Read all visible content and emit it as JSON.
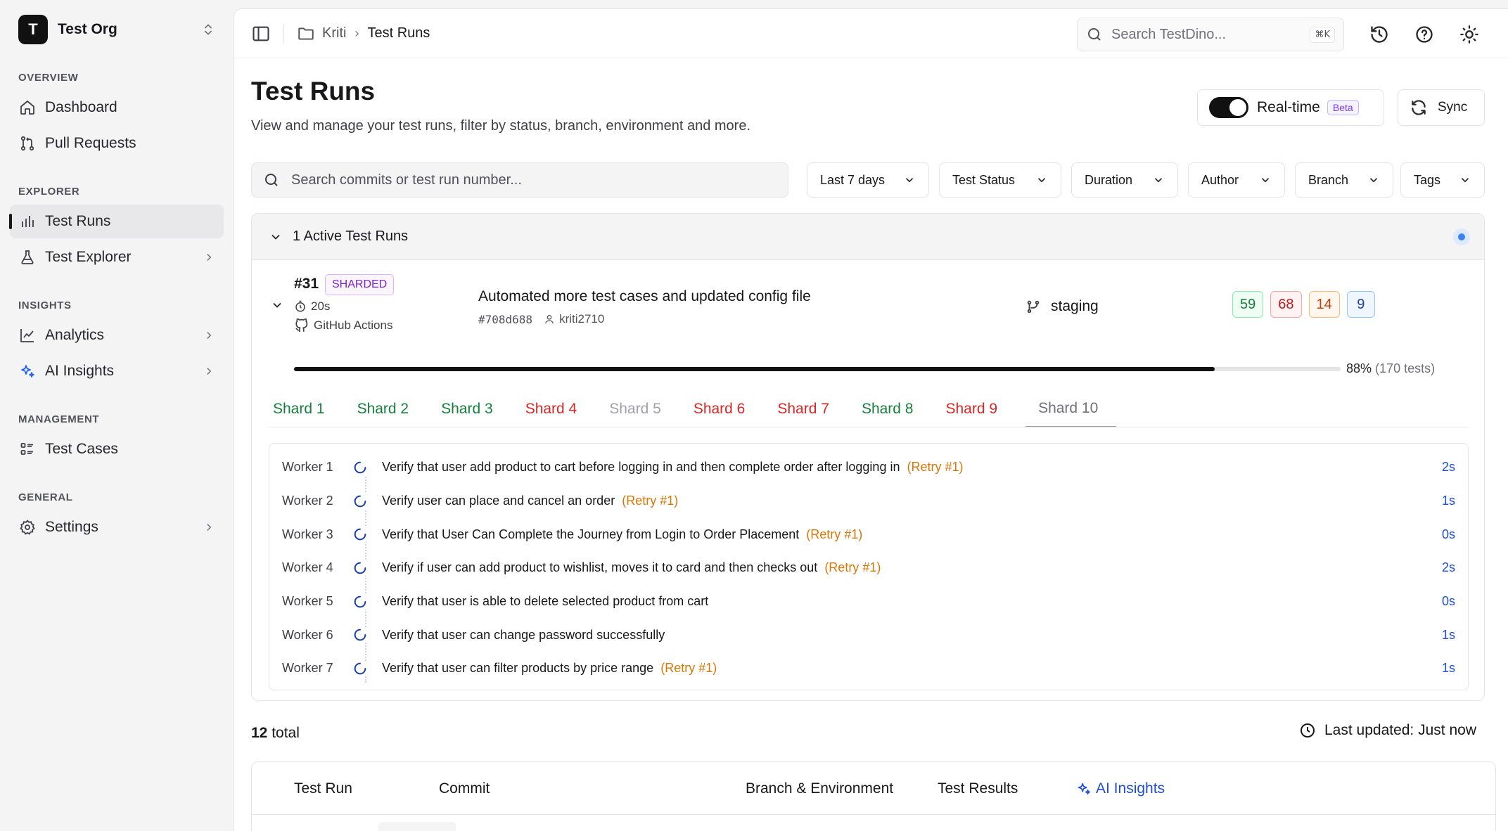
{
  "org": {
    "initial": "T",
    "name": "Test Org"
  },
  "sidebar": {
    "sections": [
      {
        "label": "OVERVIEW",
        "items": [
          {
            "label": "Dashboard",
            "icon": "home-icon"
          },
          {
            "label": "Pull Requests",
            "icon": "git-pull-request-icon"
          }
        ]
      },
      {
        "label": "EXPLORER",
        "items": [
          {
            "label": "Test Runs",
            "icon": "bar-chart-icon",
            "active": true
          },
          {
            "label": "Test Explorer",
            "icon": "flask-icon",
            "chevron": true
          }
        ]
      },
      {
        "label": "INSIGHTS",
        "items": [
          {
            "label": "Analytics",
            "icon": "line-chart-icon",
            "chevron": true
          },
          {
            "label": "AI Insights",
            "icon": "sparkles-icon",
            "chevron": true
          }
        ]
      },
      {
        "label": "MANAGEMENT",
        "items": [
          {
            "label": "Test Cases",
            "icon": "list-icon"
          }
        ]
      },
      {
        "label": "GENERAL",
        "items": [
          {
            "label": "Settings",
            "icon": "gear-icon",
            "chevron": true
          }
        ]
      }
    ]
  },
  "topbar": {
    "breadcrumb": [
      "Kriti",
      "Test Runs"
    ],
    "search_placeholder": "Search TestDino...",
    "search_shortcut": "⌘K"
  },
  "page": {
    "title": "Test Runs",
    "subtitle": "View and manage your test runs, filter by status, branch, environment and more.",
    "realtime_label": "Real-time",
    "realtime_on": true,
    "beta_label": "Beta",
    "sync_label": "Sync"
  },
  "filters": {
    "search_placeholder": "Search commits or test run number...",
    "buttons": [
      "Last 7 days",
      "Test Status",
      "Duration",
      "Author",
      "Branch",
      "Tags"
    ]
  },
  "active_runs": {
    "header": "1 Active Test Runs",
    "run": {
      "number": "#31",
      "badge": "SHARDED",
      "duration": "20s",
      "ci": "GitHub Actions",
      "commit_message": "Automated more test cases and updated config file",
      "commit_hash": "#708d688",
      "author": "kriti2710",
      "branch": "staging",
      "counts": {
        "passed": "59",
        "failed": "68",
        "flaky": "14",
        "skipped": "9"
      },
      "progress_percent": 88,
      "progress_label": "88%",
      "progress_tests": "(170 tests)"
    },
    "shards": [
      {
        "label": "Shard 1",
        "status": "green"
      },
      {
        "label": "Shard 2",
        "status": "green"
      },
      {
        "label": "Shard 3",
        "status": "green"
      },
      {
        "label": "Shard 4",
        "status": "red"
      },
      {
        "label": "Shard 5",
        "status": "gray"
      },
      {
        "label": "Shard 6",
        "status": "red"
      },
      {
        "label": "Shard 7",
        "status": "red"
      },
      {
        "label": "Shard 8",
        "status": "green"
      },
      {
        "label": "Shard 9",
        "status": "red"
      },
      {
        "label": "Shard 10",
        "status": "selected"
      }
    ],
    "workers": [
      {
        "name": "Worker 1",
        "test": "Verify that user add product to cart before logging in and then complete order after logging in",
        "retry": "(Retry #1)",
        "time": "2s"
      },
      {
        "name": "Worker 2",
        "test": "Verify user can place and cancel an order",
        "retry": "(Retry #1)",
        "time": "1s"
      },
      {
        "name": "Worker 3",
        "test": "Verify that User Can Complete the Journey from Login to Order Placement",
        "retry": "(Retry #1)",
        "time": "0s"
      },
      {
        "name": "Worker 4",
        "test": "Verify if user can add product to wishlist, moves it to card and then checks out",
        "retry": "(Retry #1)",
        "time": "2s"
      },
      {
        "name": "Worker 5",
        "test": "Verify that user is able to delete selected product from cart",
        "retry": "",
        "time": "0s"
      },
      {
        "name": "Worker 6",
        "test": "Verify that user can change password successfully",
        "retry": "",
        "time": "1s"
      },
      {
        "name": "Worker 7",
        "test": "Verify that user can filter products by price range",
        "retry": "(Retry #1)",
        "time": "1s"
      }
    ]
  },
  "list": {
    "total_count": "12",
    "total_label": "total",
    "last_updated": "Last updated: Just now",
    "columns": [
      "Test Run",
      "Commit",
      "Branch & Environment",
      "Test Results",
      "AI Insights"
    ]
  },
  "colors": {
    "pass": "#15803d",
    "fail": "#b91c1c",
    "flaky": "#c2410c",
    "skip": "#1e40af",
    "accent": "#1d4ed8"
  }
}
